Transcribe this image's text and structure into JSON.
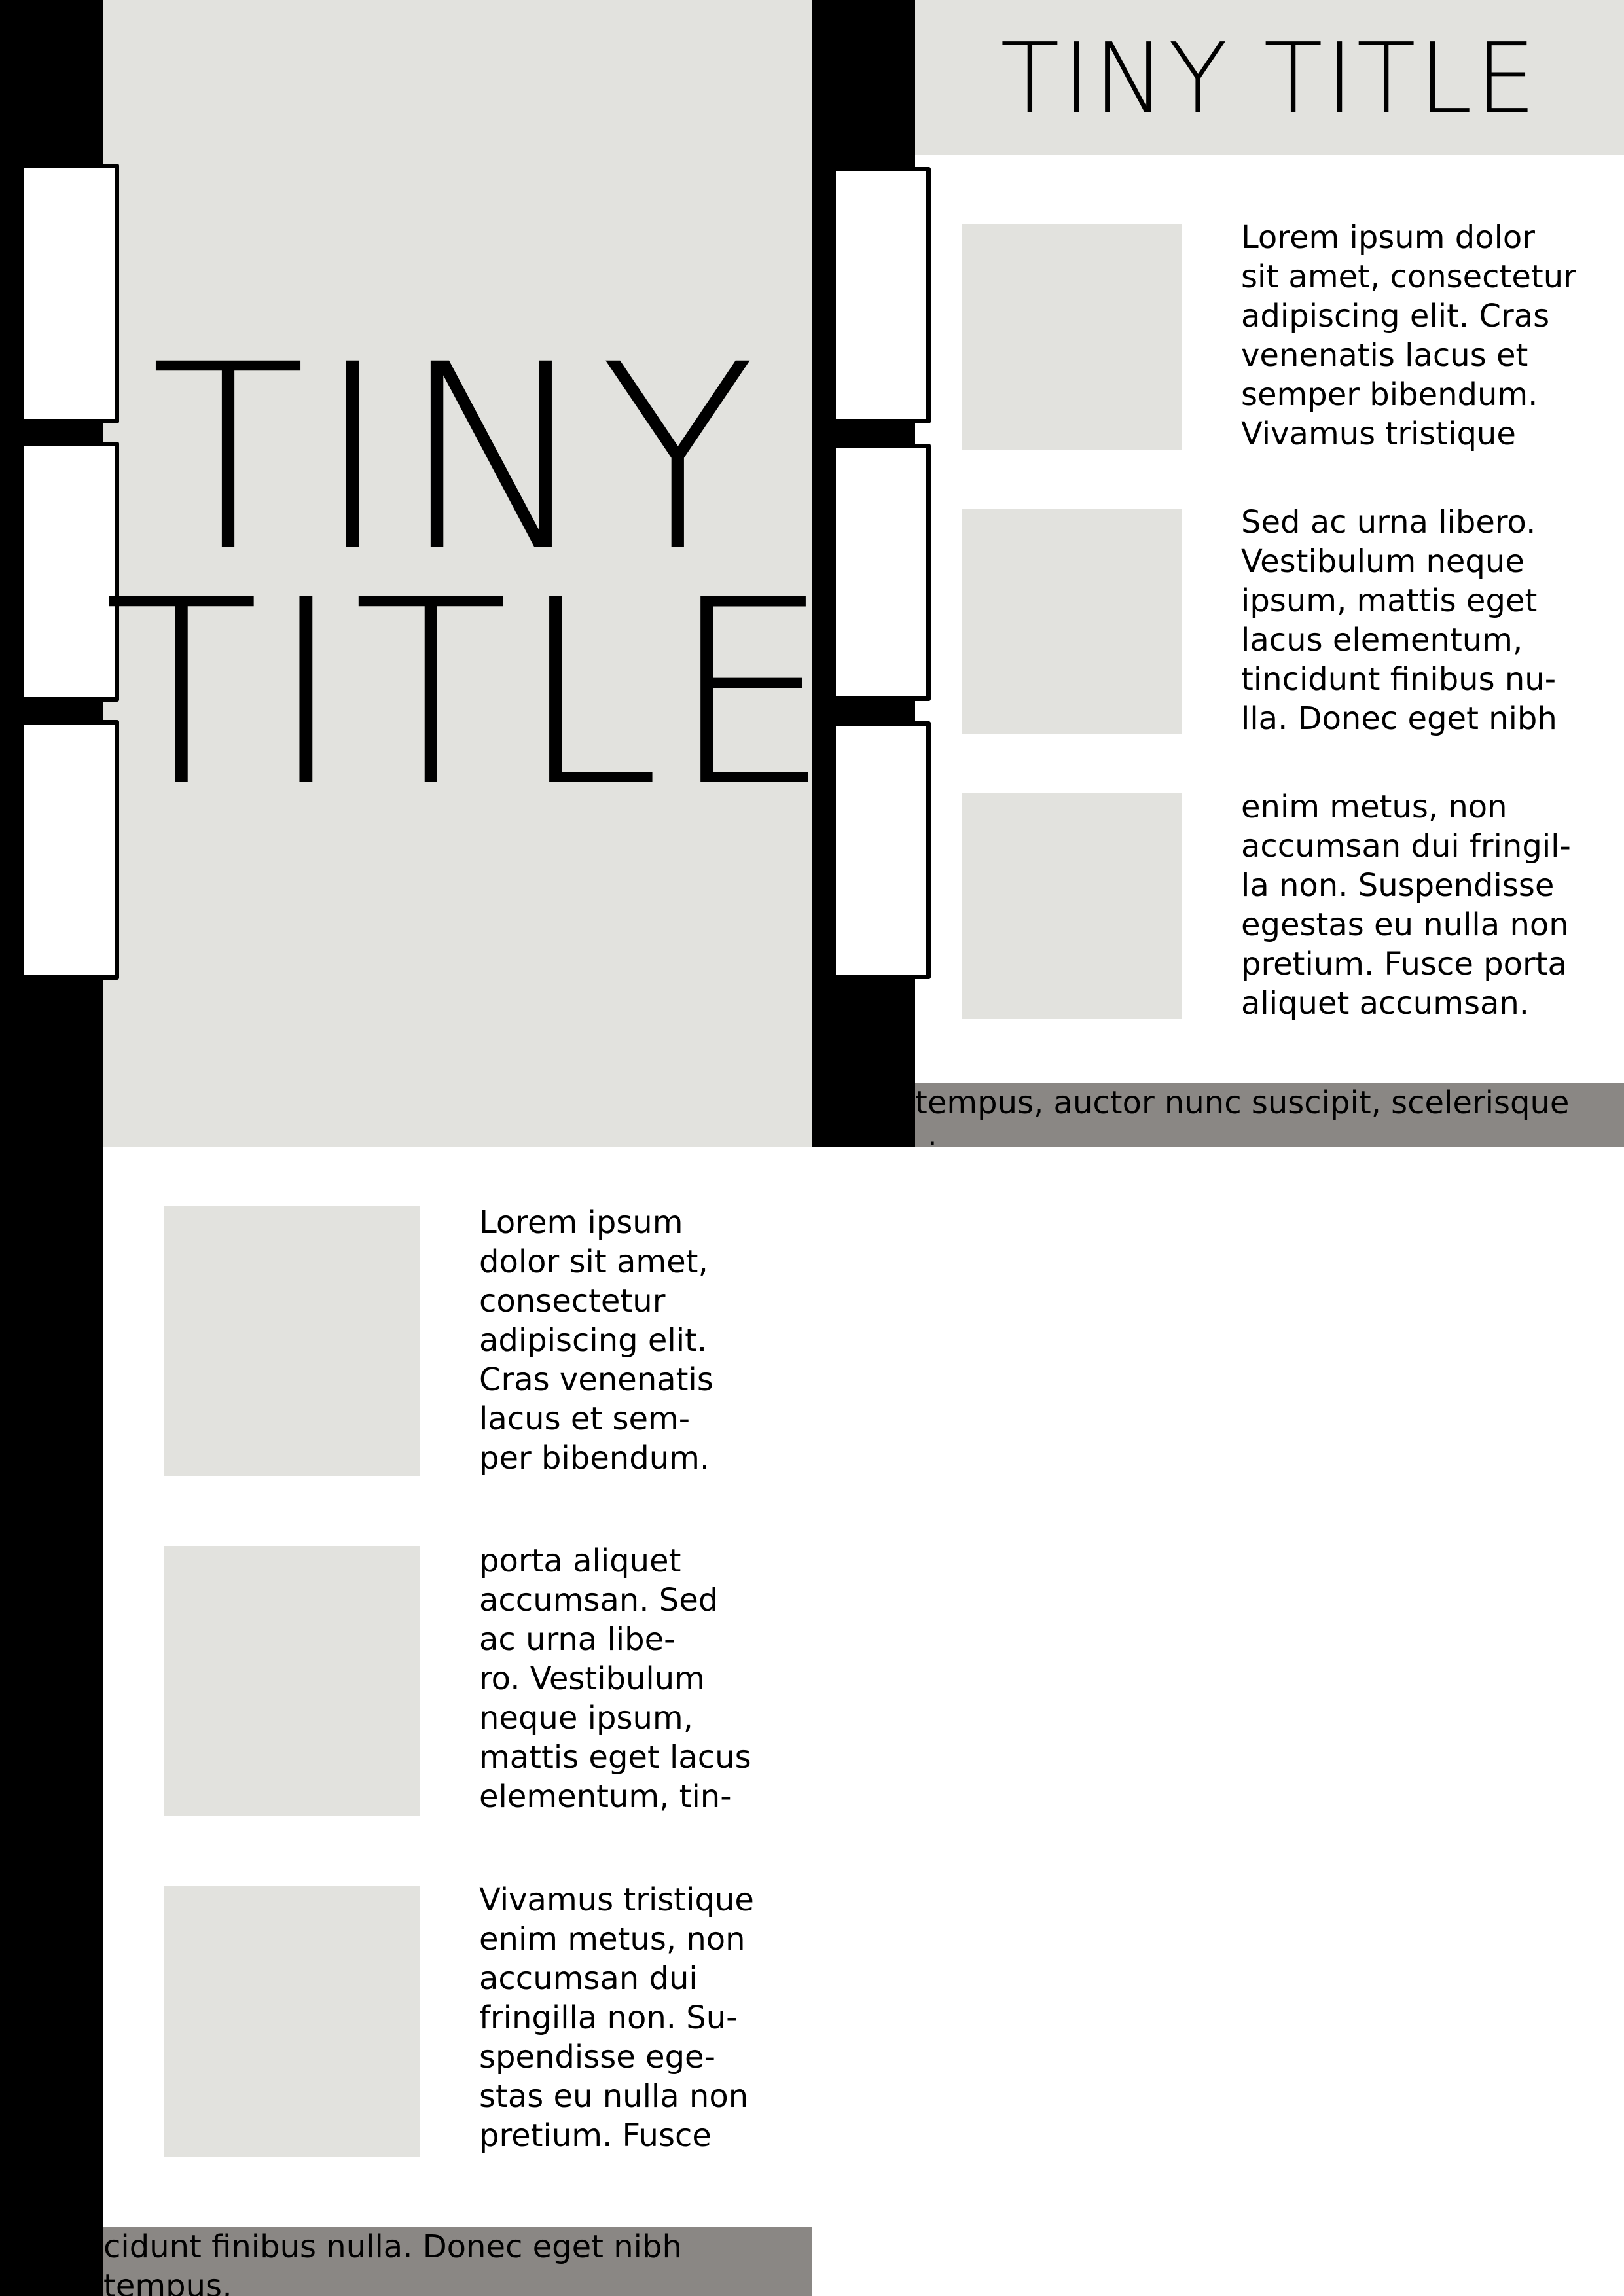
{
  "left_page": {
    "title": "TINY\nTITLE",
    "blocks": [
      "Lorem ipsum\ndolor sit amet,\nconsectetur\nadipiscing elit.\nCras venenatis\nlacus et sem-\nper bibendum.",
      "porta aliquet\naccumsan. Sed\nac urna libe-\nro. Vestibulum\nneque ipsum,\nmattis eget lacus\nelementum, tin-",
      "Vivamus tristique\nenim metus, non\naccumsan dui\nfringilla non. Su-\nspendisse ege-\nstas eu nulla non\npretium. Fusce"
    ],
    "footer_strip": "cidunt finibus nulla. Donec eget nibh tempus,\nauctor nunc suscipit, scelerisque risus. Aenean"
  },
  "right_page": {
    "title": "TINY TITLE",
    "blocks": [
      "Lorem ipsum dolor\nsit amet, consectetur\nadipiscing elit. Cras\nvenenatis lacus et\nsemper bibendum.\nVivamus tristique",
      "Sed ac urna libero.\nVestibulum neque\nipsum, mattis eget\nlacus elementum,\ntincidunt finibus nu-\nlla. Donec eget nibh",
      "enim metus, non\naccumsan dui fringil-\nla non. Suspendisse\negestas eu nulla non\npretium. Fusce porta\naliquet accumsan."
    ],
    "footer_strip": "tempus, auctor nunc suscipit, scelerisque risus.\nAenean facilisis suscipit libero, vitae ultrices"
  },
  "colors": {
    "panel_grey": "#e2e2de",
    "strip_grey": "#8a8784",
    "sidebar_black": "#000000"
  }
}
